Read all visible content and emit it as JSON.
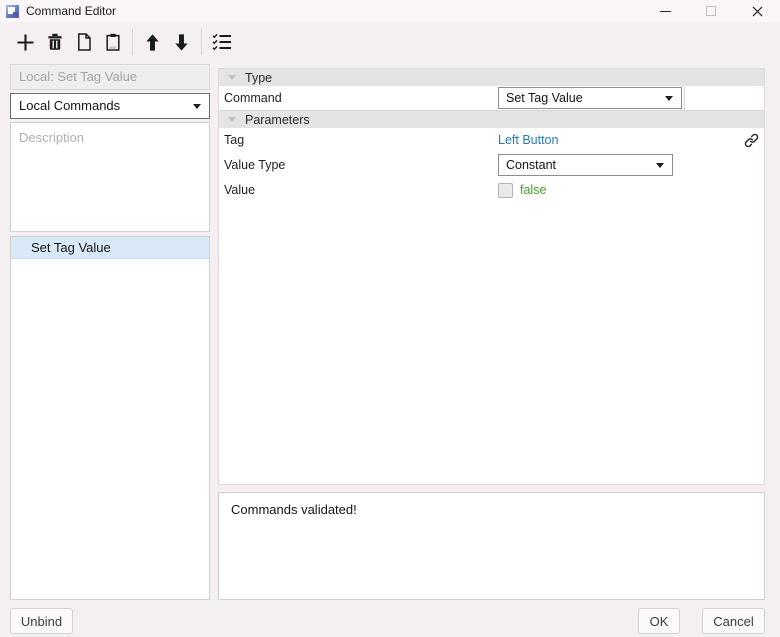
{
  "window": {
    "title": "Command Editor"
  },
  "toolbar": {
    "buttons": [
      {
        "icon": "plus-icon",
        "action": "add-command"
      },
      {
        "icon": "trash-icon",
        "action": "delete-command"
      },
      {
        "icon": "copy-icon",
        "action": "copy-command"
      },
      {
        "icon": "paste-icon",
        "action": "paste-command"
      },
      {
        "icon": "arrow-up-icon",
        "action": "move-up"
      },
      {
        "icon": "arrow-down-icon",
        "action": "move-down"
      },
      {
        "icon": "checklist-icon",
        "action": "validate-commands"
      }
    ]
  },
  "left_panel": {
    "name_field_value": "Local: Set Tag Value",
    "scope_dropdown_value": "Local Commands",
    "description_placeholder": "Description",
    "command_list": [
      {
        "label": "Set Tag Value",
        "selected": true
      }
    ]
  },
  "property_grid": {
    "type_section_label": "Type",
    "command_label": "Command",
    "command_value": "Set Tag Value",
    "parameters_section_label": "Parameters",
    "tag_label": "Tag",
    "tag_value": "Left Button",
    "value_type_label": "Value Type",
    "value_type_value": "Constant",
    "value_label": "Value",
    "value_checkbox_checked": false,
    "value_text": "false"
  },
  "validation": {
    "message": "Commands validated!"
  },
  "footer": {
    "unbind_label": "Unbind",
    "ok_label": "OK",
    "cancel_label": "Cancel"
  },
  "colors": {
    "link_blue": "#2a7ab5",
    "value_green": "#47a02b",
    "selection_blue": "#d9e9f8",
    "titlebar_bg": "#faf5f6",
    "section_header_bg": "#e6e3e4"
  }
}
